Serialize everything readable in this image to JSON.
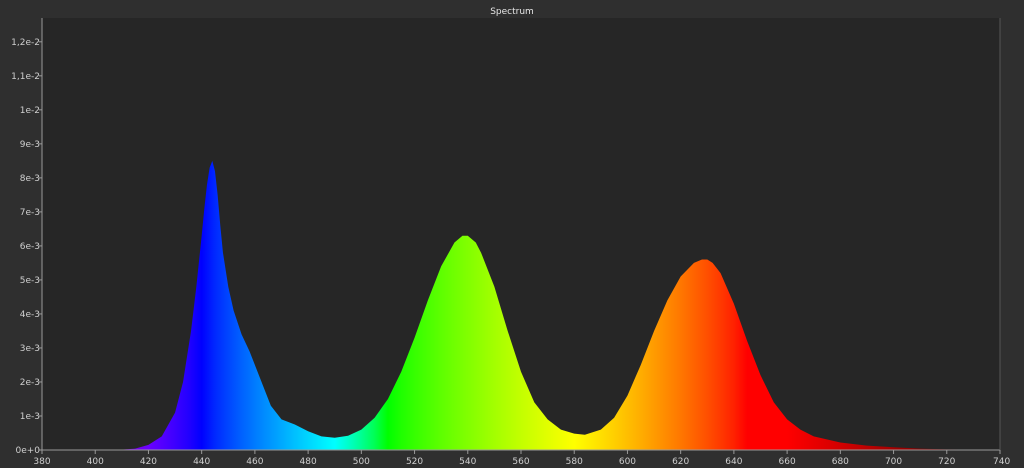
{
  "window": {
    "title": "Spectrum"
  },
  "colors": {
    "window_bg": "#2f2f2f",
    "plot_bg": "#262626",
    "axis": "#9a9a9a",
    "tick_text": "#cfcfcf"
  },
  "chart_data": {
    "type": "area",
    "title": "Spectrum",
    "xlabel": "",
    "ylabel": "",
    "xlim": [
      380,
      740
    ],
    "ylim": [
      0,
      0.0127
    ],
    "grid": false,
    "legend": "none",
    "fill": "wavelength spectral colors",
    "x_ticks": [
      380,
      400,
      420,
      440,
      460,
      480,
      500,
      520,
      540,
      560,
      580,
      600,
      620,
      640,
      660,
      680,
      700,
      720,
      740
    ],
    "x_tick_labels": [
      "380",
      "400",
      "420",
      "440",
      "460",
      "480",
      "500",
      "520",
      "540",
      "560",
      "580",
      "600",
      "620",
      "640",
      "660",
      "680",
      "700",
      "720",
      "740"
    ],
    "y_ticks": [
      0,
      0.001,
      0.002,
      0.003,
      0.004,
      0.005,
      0.006,
      0.007,
      0.008,
      0.009,
      0.01,
      0.011,
      0.012
    ],
    "y_tick_labels": [
      "0e+0",
      "1e-3",
      "2e-3",
      "3e-3",
      "4e-3",
      "5e-3",
      "6e-3",
      "7e-3",
      "8e-3",
      "9e-3",
      "1e-2",
      "1,1e-2",
      "1,2e-2"
    ],
    "series": [
      {
        "x": [
          380,
          400,
          410,
          415,
          420,
          425,
          430,
          433,
          436,
          438,
          440,
          441,
          442,
          443,
          444,
          445,
          446,
          447,
          448,
          450,
          452,
          455,
          458,
          460,
          463,
          466,
          470,
          475,
          480,
          485,
          490,
          495,
          500,
          505,
          510,
          515,
          520,
          525,
          530,
          535,
          538,
          540,
          543,
          545,
          550,
          555,
          560,
          565,
          570,
          575,
          580,
          584,
          590,
          595,
          600,
          605,
          610,
          615,
          620,
          625,
          628,
          630,
          632,
          635,
          640,
          645,
          650,
          655,
          660,
          665,
          670,
          680,
          690,
          700,
          710,
          720,
          730,
          740
        ],
        "y": [
          0,
          0,
          1e-05,
          4e-05,
          0.00015,
          0.0004,
          0.0011,
          0.002,
          0.0035,
          0.0048,
          0.0063,
          0.0071,
          0.0078,
          0.0083,
          0.0085,
          0.0082,
          0.0075,
          0.0066,
          0.0058,
          0.0048,
          0.0041,
          0.0034,
          0.0029,
          0.0025,
          0.0019,
          0.0013,
          0.0009,
          0.00075,
          0.00055,
          0.0004,
          0.00036,
          0.00042,
          0.0006,
          0.00095,
          0.0015,
          0.0023,
          0.0033,
          0.0044,
          0.0054,
          0.0061,
          0.0063,
          0.0063,
          0.0061,
          0.0058,
          0.0048,
          0.0035,
          0.0023,
          0.0014,
          0.0009,
          0.0006,
          0.00048,
          0.00045,
          0.0006,
          0.00095,
          0.0016,
          0.0025,
          0.0035,
          0.0044,
          0.0051,
          0.0055,
          0.0056,
          0.0056,
          0.0055,
          0.0052,
          0.0043,
          0.0032,
          0.0022,
          0.0014,
          0.0009,
          0.0006,
          0.0004,
          0.00022,
          0.00013,
          8e-05,
          4e-05,
          2e-05,
          1e-05,
          0
        ]
      }
    ]
  }
}
